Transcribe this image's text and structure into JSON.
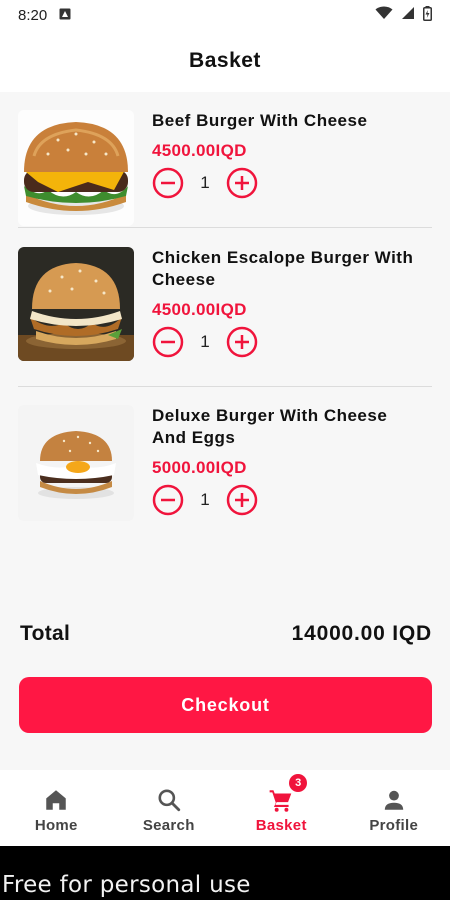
{
  "status_bar": {
    "time": "8:20"
  },
  "header": {
    "title": "Basket"
  },
  "items": [
    {
      "name": "Beef Burger With Cheese",
      "price": "4500.00IQD",
      "quantity": "1"
    },
    {
      "name": "Chicken Escalope Burger With Cheese",
      "price": "4500.00IQD",
      "quantity": "1"
    },
    {
      "name": "Deluxe Burger With Cheese And Eggs",
      "price": "5000.00IQD",
      "quantity": "1"
    }
  ],
  "summary": {
    "total_label": "Total",
    "total_value": "14000.00 IQD"
  },
  "checkout": {
    "label": "Checkout"
  },
  "nav": {
    "items": [
      {
        "label": "Home",
        "icon": "home-icon"
      },
      {
        "label": "Search",
        "icon": "search-icon"
      },
      {
        "label": "Basket",
        "icon": "cart-icon",
        "badge": "3",
        "active": true
      },
      {
        "label": "Profile",
        "icon": "person-icon"
      }
    ]
  },
  "footer": {
    "watermark": "Free for personal use"
  },
  "colors": {
    "accent": "#ff1744",
    "price": "#f0143c",
    "background": "#f7f7f7"
  }
}
